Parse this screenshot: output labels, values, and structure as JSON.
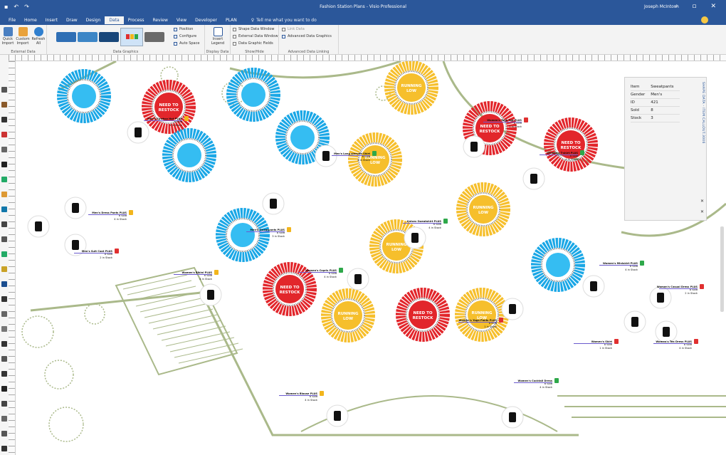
{
  "window": {
    "title": "Fashion Station Plans - Visio Professional",
    "user": "Joseph McIntosh"
  },
  "tabs": [
    "File",
    "Home",
    "Insert",
    "Draw",
    "Design",
    "Data",
    "Process",
    "Review",
    "View",
    "Developer",
    "PLAN"
  ],
  "active_tab": "Data",
  "tell_me": "Tell me what you want to do",
  "ribbon": {
    "groups": [
      {
        "caption": "External Data",
        "buttons": [
          "Quick Import",
          "Custom Import",
          "Refresh All"
        ]
      },
      {
        "caption": "Data Graphics"
      },
      {
        "caption": "Display Data",
        "buttons": [
          "Insert Legend"
        ]
      },
      {
        "caption": "Show/Hide"
      },
      {
        "caption": "Advanced Data Linking"
      }
    ],
    "data_graphics_small": [
      "Position",
      "Configure",
      "Auto Space"
    ],
    "show_hide": [
      "Shape Data Window",
      "External Data Window",
      "Data Graphic Fields"
    ],
    "advanced": [
      "Link Data",
      "Advanced Data Graphics"
    ]
  },
  "shape_data": {
    "title": "SHAPE DATA - ITEM CALLOUT.3006",
    "rows": [
      [
        "Item",
        "Sweatpants"
      ],
      [
        "Gender",
        "Men's"
      ],
      [
        "ID",
        "421"
      ],
      [
        "Sold",
        "8"
      ],
      [
        "Stock",
        "3"
      ]
    ]
  },
  "rack_text": {
    "restock": [
      "NEED TO",
      "RESTOCK"
    ],
    "low": [
      "RUNNING",
      "LOW"
    ]
  },
  "racks": [
    {
      "status": "blue"
    },
    {
      "status": "red"
    },
    {
      "status": "blue"
    },
    {
      "status": "blue"
    },
    {
      "status": "blue"
    },
    {
      "status": "yellow"
    },
    {
      "status": "yellow"
    },
    {
      "status": "red"
    },
    {
      "status": "red"
    },
    {
      "status": "blue"
    },
    {
      "status": "yellow"
    },
    {
      "status": "yellow"
    },
    {
      "status": "red"
    },
    {
      "status": "yellow"
    },
    {
      "status": "red"
    },
    {
      "status": "yellow"
    },
    {
      "status": "blue"
    }
  ],
  "colors": {
    "blue": "#1aa7e6",
    "blue_center": "#35bdf2",
    "red": "#e2262b",
    "yellow": "#f6bf2c",
    "ribbon_blue": "#2b579a"
  },
  "callouts": [
    {
      "name": "Men's Cowboy Hat PLUS",
      "sold": "8 Sold",
      "stock": "4 in Stock",
      "flag": "warn"
    },
    {
      "name": "Men's Long sleeved Shirt",
      "sold": "6 Sold",
      "stock": "4 in Stock",
      "flag": "ok"
    },
    {
      "name": "Women's Tank Top PLUS",
      "sold": "8 Sold",
      "stock": "1 in Stock",
      "flag": "bad"
    },
    {
      "name": "Women's T-shirt PLUS",
      "sold": "8 Sold",
      "stock": "4 in Stock",
      "flag": "ok"
    },
    {
      "name": "Men's Dress Pants PLUS",
      "sold": "6 Sold",
      "stock": "4 in Stock",
      "flag": "warn"
    },
    {
      "name": "Men's Sweatpants PLUS",
      "sold": "8 Sold",
      "stock": "3 in Stock",
      "flag": "warn"
    },
    {
      "name": "Unisex Sweatshirt PLUS",
      "sold": "6 Sold",
      "stock": "4 in Stock",
      "flag": "ok"
    },
    {
      "name": "Men's Suit Coat PLUS",
      "sold": "8 Sold",
      "stock": "2 in Stock",
      "flag": "bad"
    },
    {
      "name": "Women's Capris PLUS",
      "sold": "8 Sold",
      "stock": "4 in Stock",
      "flag": "ok"
    },
    {
      "name": "Women's Bikini PLUS",
      "sold": "6 Sold",
      "stock": "4 in Stock",
      "flag": "warn"
    },
    {
      "name": "Women's Yoga Pants PLUS",
      "sold": "8 Sold",
      "stock": "1 in Stock",
      "flag": "bad"
    },
    {
      "name": "Women's Miniskirt PLUS",
      "sold": "6 Sold",
      "stock": "4 in Stock",
      "flag": "ok"
    },
    {
      "name": "Women's Casual Dress PLUS",
      "sold": "8 Sold",
      "stock": "2 in Stock",
      "flag": "bad"
    },
    {
      "name": "Women's Skirt",
      "sold": "8 Sold",
      "stock": "1 in Stock",
      "flag": "bad"
    },
    {
      "name": "Women's Tea Dress PLUS",
      "sold": "8 Sold",
      "stock": "4 in Stock",
      "flag": "bad"
    },
    {
      "name": "Women's Blouse PLUS",
      "sold": "6 Sold",
      "stock": "4 in Stock",
      "flag": "warn"
    },
    {
      "name": "Women's Cocktail Dress",
      "sold": "6 Sold",
      "stock": "4 in Stock",
      "flag": "ok"
    }
  ]
}
